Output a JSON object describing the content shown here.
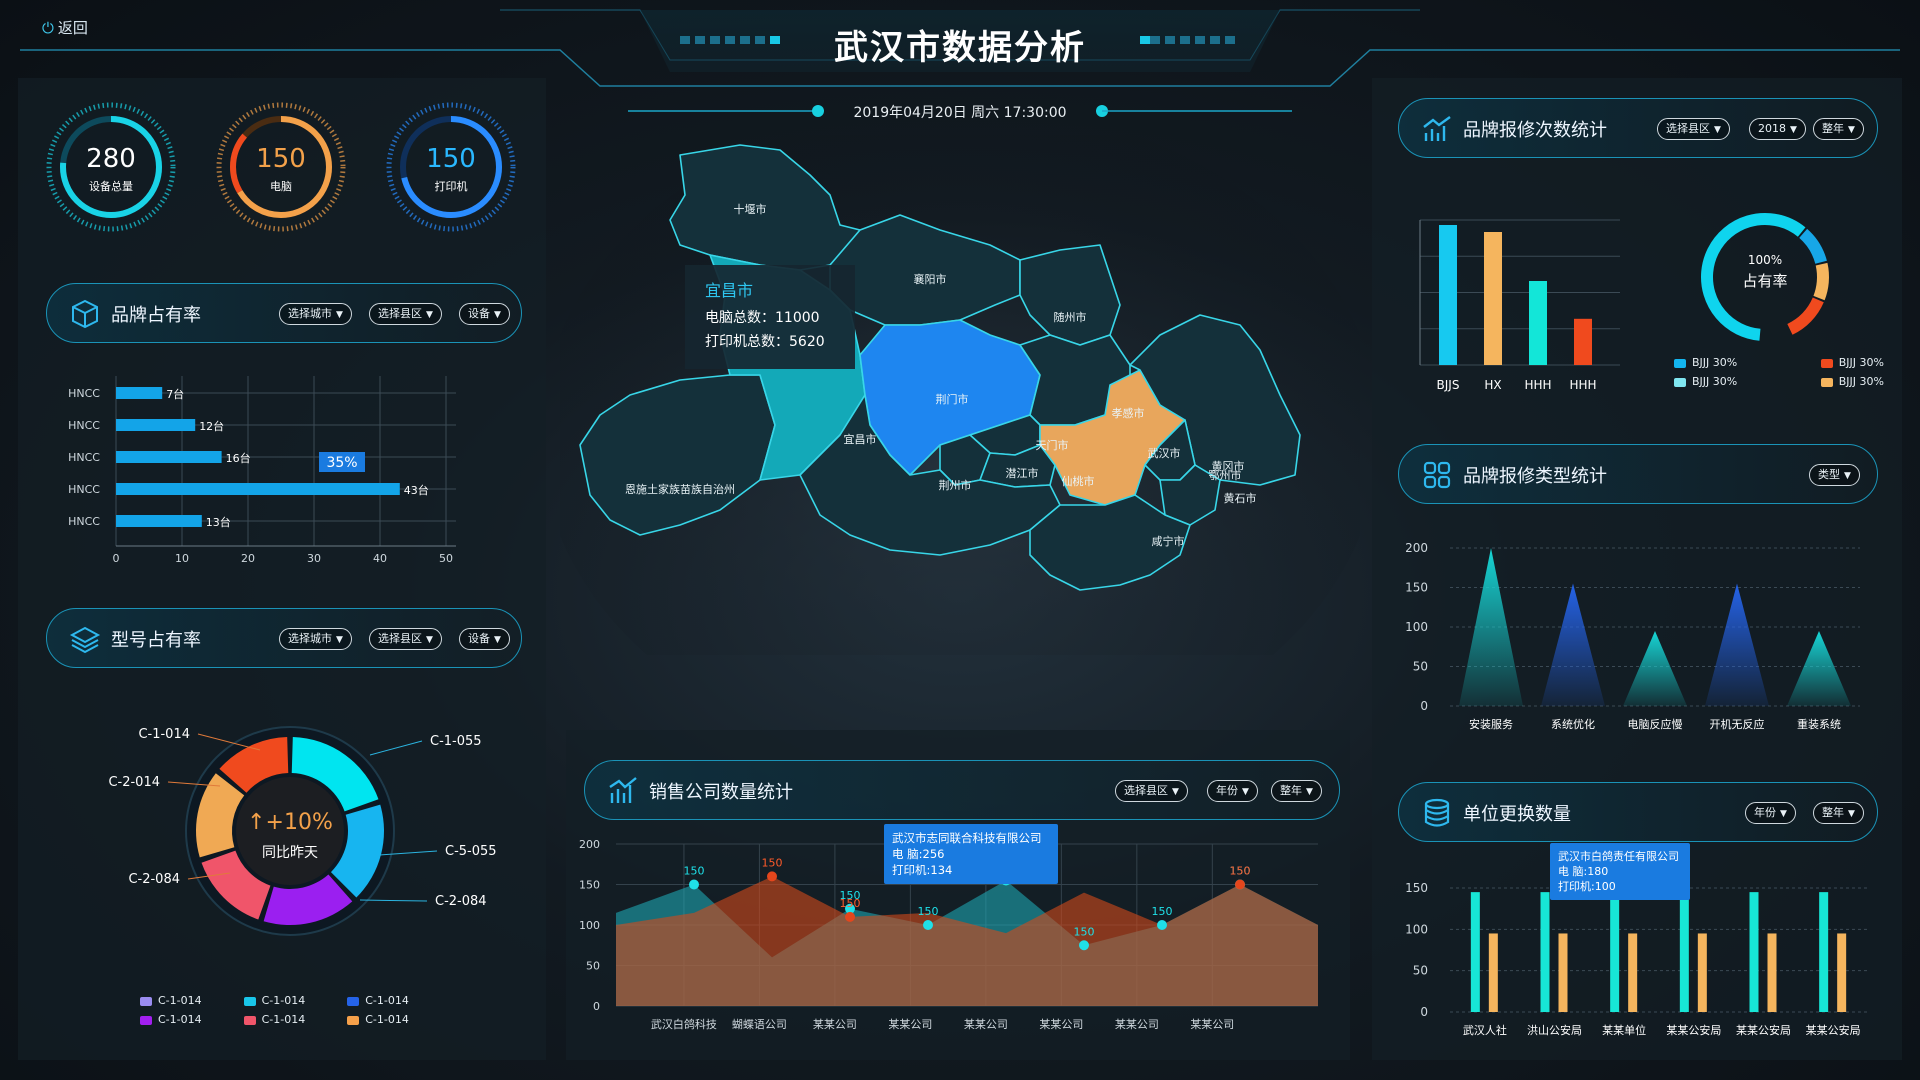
{
  "header": {
    "back_label": "返回",
    "title": "武汉市数据分析",
    "datetime": "2019年04月20日  周六  17:30:00"
  },
  "rings": [
    {
      "value": "280",
      "label": "设备总量",
      "color": "#19d3e6"
    },
    {
      "value": "150",
      "label": "电脑",
      "color": "#f3a14a"
    },
    {
      "value": "150",
      "label": "打印机",
      "color": "#2a8cff"
    }
  ],
  "brand_share": {
    "title": "品牌占有率",
    "filters": [
      "选择城市",
      "选择县区",
      "设备"
    ],
    "chart_data": {
      "type": "bar",
      "orientation": "horizontal",
      "categories": [
        "HNCC",
        "HNCC",
        "HNCC",
        "HNCC",
        "HNCC"
      ],
      "values": [
        7,
        12,
        16,
        43,
        13
      ],
      "value_labels": [
        "7台",
        "12台",
        "16台",
        "43台",
        "13台"
      ],
      "xlim": [
        0,
        50
      ],
      "xticks": [
        "0",
        "10",
        "20",
        "30",
        "40",
        "50"
      ],
      "annotation": "35%",
      "color": "#13a4e8"
    }
  },
  "model_share": {
    "title": "型号占有率",
    "filters": [
      "选择城市",
      "选择县区",
      "设备"
    ],
    "center_value": "+10%",
    "center_label": "同比昨天",
    "labels_left": [
      "C-1-014",
      "C-2-014",
      "C-2-084"
    ],
    "labels_right": [
      "C-1-055",
      "C-5-055",
      "C-2-084"
    ],
    "chart_data": {
      "type": "pie",
      "slices": [
        {
          "color": "#00e5f0",
          "value": 20
        },
        {
          "color": "#17b5f0",
          "value": 18
        },
        {
          "color": "#9b1ff0",
          "value": 17
        },
        {
          "color": "#f0556a",
          "value": 15
        },
        {
          "color": "#f0a954",
          "value": 16
        },
        {
          "color": "#f04a1e",
          "value": 14
        }
      ]
    },
    "legend": [
      {
        "label": "C-1-014",
        "color": "#9a8cf0"
      },
      {
        "label": "C-1-014",
        "color": "#19c6ea"
      },
      {
        "label": "C-1-014",
        "color": "#2563e8"
      },
      {
        "label": "C-1-014",
        "color": "#a21ff0"
      },
      {
        "label": "C-1-014",
        "color": "#f0556a"
      },
      {
        "label": "C-1-014",
        "color": "#f5a04a"
      }
    ]
  },
  "map": {
    "tooltip_city": "宜昌市",
    "tooltip_pc": "电脑总数：11000",
    "tooltip_printer": "打印机总数：5620",
    "cities": {
      "shiyan": "十堰市",
      "xiangyang": "襄阳市",
      "suizhou": "随州市",
      "jingmen": "荆门市",
      "xiaogan": "孝感市",
      "enshi": "恩施土家族苗族自治州",
      "yichang": "宜昌市",
      "tianmen": "天门市",
      "qianjiang": "潜江市",
      "xiantao": "仙桃市",
      "jingzhou": "荆州市",
      "wuhan": "武汉市",
      "huanggang": "黄冈市",
      "ezhou": "鄂州市",
      "huangshi": "黄石市",
      "xianning": "咸宁市"
    }
  },
  "sales": {
    "title": "销售公司数量统计",
    "filters": [
      "选择县区",
      "年份",
      "整年"
    ],
    "tooltip": {
      "line1": "武汉市志同联合科技有限公司",
      "line2": "电  脑:256",
      "line3": "打印机:134"
    },
    "chart_data": {
      "type": "area",
      "categories": [
        "武汉白鸽科技",
        "蝴蝶语公司",
        "某某公司",
        "某某公司",
        "某某公司",
        "某某公司",
        "某某公司",
        "某某公司"
      ],
      "ylim": [
        0,
        200
      ],
      "yticks": [
        "0",
        "50",
        "100",
        "150",
        "200"
      ],
      "series": [
        {
          "color": "#1fb3c0",
          "values": [
            115,
            150,
            60,
            120,
            100,
            155,
            75,
            100,
            150,
            100
          ]
        },
        {
          "color": "#d34a1a",
          "values": [
            100,
            115,
            160,
            110,
            115,
            90,
            140,
            100,
            150,
            100
          ]
        }
      ],
      "point_labels": [
        {
          "series": 0,
          "index": 1,
          "label": "150"
        },
        {
          "series": 0,
          "index": 3,
          "label": "150"
        },
        {
          "series": 0,
          "index": 4,
          "label": "150"
        },
        {
          "series": 0,
          "index": 5,
          "label": "150"
        },
        {
          "series": 0,
          "index": 6,
          "label": "150"
        },
        {
          "series": 0,
          "index": 7,
          "label": "150"
        },
        {
          "series": 0,
          "index": 8,
          "label": "150"
        },
        {
          "series": 1,
          "index": 2,
          "label": "150"
        },
        {
          "series": 1,
          "index": 3,
          "label": "150"
        },
        {
          "series": 1,
          "index": 8,
          "label": "150"
        }
      ]
    }
  },
  "repair_count": {
    "title": "品牌报修次数统计",
    "filters": [
      "选择县区",
      "2018",
      "整年"
    ],
    "chart_data": {
      "type": "bar",
      "categories": [
        "BJJS",
        "HX",
        "HHH",
        "HHH"
      ],
      "values": [
        100,
        95,
        60,
        33
      ],
      "colors": [
        "#17c9f0",
        "#f5b55e",
        "#13e6d8",
        "#f04a1e"
      ]
    },
    "donut": {
      "percent": "100%",
      "label": "占有率",
      "segments": [
        {
          "color": "#0fd4ee",
          "value": 60
        },
        {
          "color": "#17a7e8",
          "value": 10
        },
        {
          "color": "#f5b55e",
          "value": 10
        },
        {
          "color": "#f04a1e",
          "value": 12
        }
      ]
    },
    "legend": [
      {
        "label": "BJJJ  30%",
        "color": "#13b6f0"
      },
      {
        "label": "BJJJ  30%",
        "color": "#f04a1e"
      },
      {
        "label": "BJJJ  30%",
        "color": "#7fe6f0"
      },
      {
        "label": "BJJJ  30%",
        "color": "#f5b55e"
      }
    ]
  },
  "repair_type": {
    "title": "品牌报修类型统计",
    "filters": [
      "类型"
    ],
    "chart_data": {
      "type": "bar",
      "style": "triangle",
      "categories": [
        "安装服务",
        "系统优化",
        "电脑反应慢",
        "开机无反应",
        "重装系统"
      ],
      "values": [
        200,
        155,
        95,
        155,
        95
      ],
      "colors": [
        "#17d6d6",
        "#2563e8",
        "#17d6d6",
        "#2563e8",
        "#17d6d6"
      ],
      "ylim": [
        0,
        200
      ],
      "yticks": [
        "0",
        "50",
        "100",
        "150",
        "200"
      ]
    }
  },
  "unit_replace": {
    "title": "单位更换数量",
    "filters": [
      "年份",
      "整年"
    ],
    "tooltip": {
      "line1": "武汉市白鸽责任有限公司",
      "line2": "电  脑:180",
      "line3": "打印机:100"
    },
    "chart_data": {
      "type": "bar",
      "categories": [
        "武汉人社",
        "洪山公安局",
        "某某单位",
        "某某公安局",
        "某某公安局",
        "某某公安局"
      ],
      "series": [
        {
          "color": "#17e6d6",
          "values": [
            145,
            145,
            145,
            145,
            145,
            145
          ]
        },
        {
          "color": "#f5b55e",
          "values": [
            95,
            95,
            95,
            95,
            95,
            95
          ]
        }
      ],
      "ylim": [
        0,
        150
      ],
      "yticks": [
        "0",
        "50",
        "100",
        "150"
      ]
    }
  }
}
